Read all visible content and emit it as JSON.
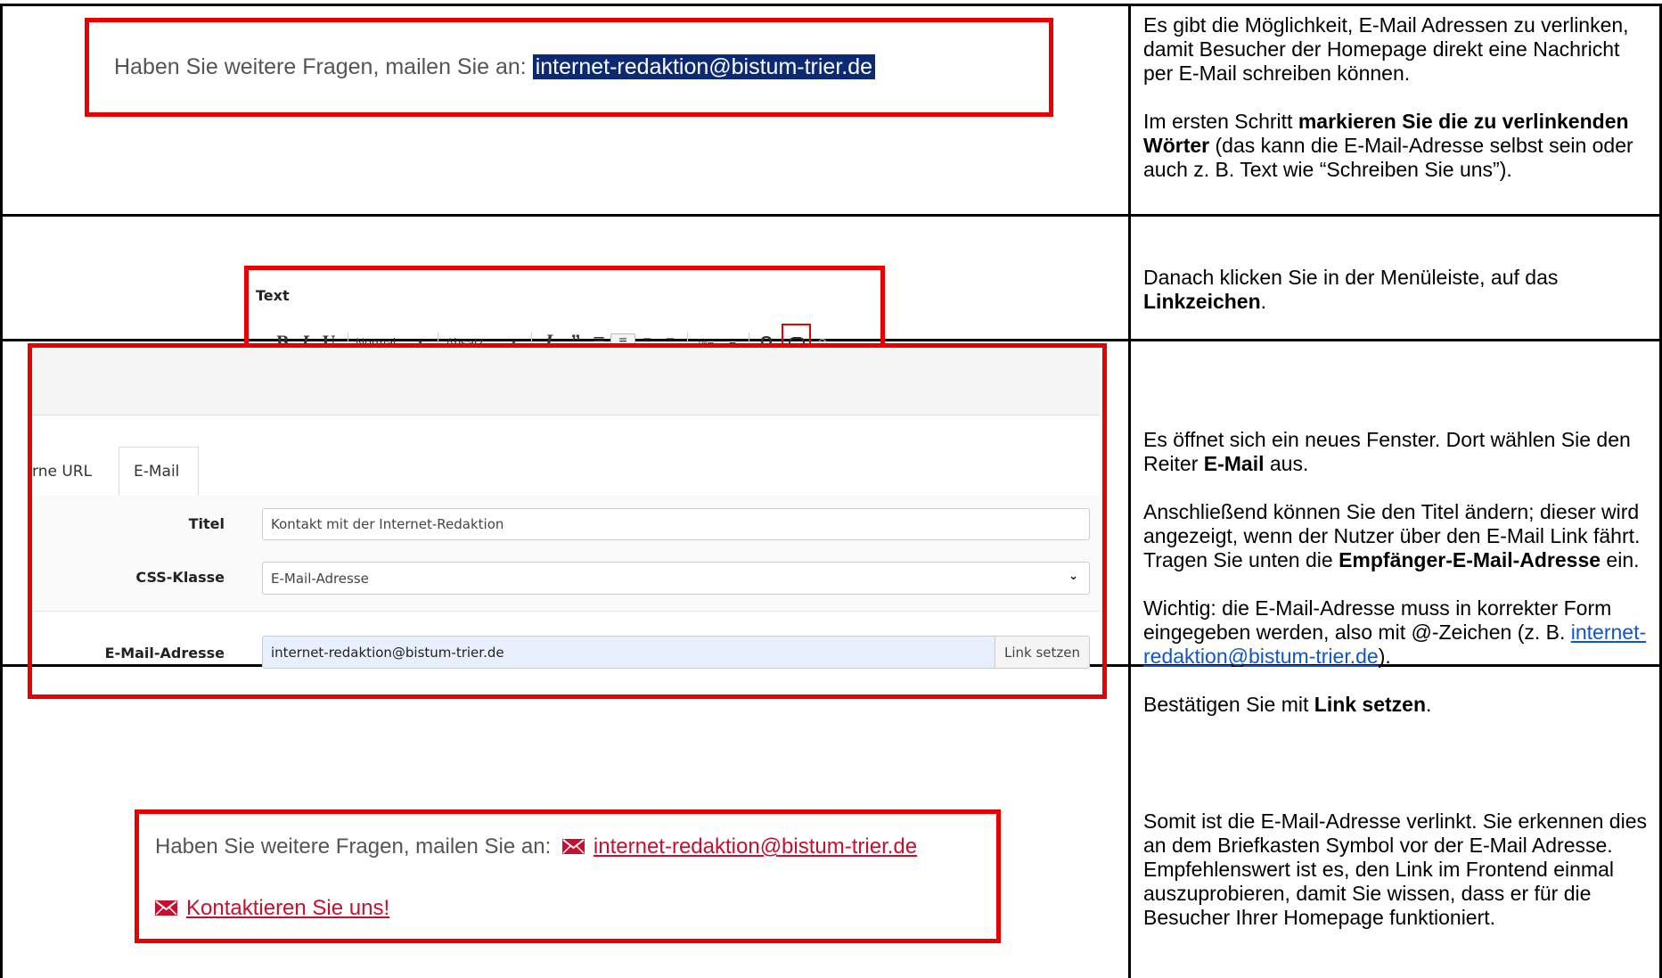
{
  "rows": [
    {
      "screenshot": {
        "sentence": "Haben Sie weitere Fragen, mailen Sie an:",
        "selected_email": "internet-redaktion@bistum-trier.de"
      },
      "paragraphs": [
        {
          "parts": [
            {
              "t": "Es gibt die Möglichkeit, E-Mail Adressen zu verlinken, damit Besucher der Homepage direkt eine Nachricht per E-Mail schreiben können."
            }
          ]
        },
        {
          "parts": [
            {
              "t": "Im ersten Schritt "
            },
            {
              "t": "markieren Sie die zu verlinkenden Wörter",
              "b": true
            },
            {
              "t": " (das kann die E-Mail-Adresse selbst sein oder auch z. B. Text wie “Schreiben Sie uns”)."
            }
          ]
        }
      ]
    },
    {
      "screenshot": {
        "label": "Text",
        "bold": "B",
        "italic": "I",
        "underline": "U",
        "style_select": "Normal",
        "format_select": "Absatz",
        "omega": "Ω"
      },
      "paragraphs": [
        {
          "parts": [
            {
              "t": "Danach klicken Sie in der Menüleiste, auf das "
            },
            {
              "t": "Linkzeichen",
              "b": true
            },
            {
              "t": "."
            }
          ]
        }
      ]
    },
    {
      "screenshot": {
        "tab_url": "rne URL",
        "tab_email": "E-Mail",
        "titel_label": "Titel",
        "titel_value": "Kontakt mit der Internet-Redaktion",
        "css_label": "CSS-Klasse",
        "css_value": "E-Mail-Adresse",
        "email_label": "E-Mail-Adresse",
        "email_value": "internet-redaktion@bistum-trier.de",
        "submit": "Link setzen"
      },
      "paragraphs": [
        {
          "parts": [
            {
              "t": "Es öffnet sich ein neues Fenster. Dort wählen Sie den Reiter "
            },
            {
              "t": "E-Mail",
              "b": true
            },
            {
              "t": " aus."
            }
          ]
        },
        {
          "parts": [
            {
              "t": "Anschließend können Sie den Titel ändern; dieser wird angezeigt, wenn der Nutzer über den E-Mail Link fährt. Tragen Sie unten die "
            },
            {
              "t": "Empfänger-E-Mail-Adresse",
              "b": true
            },
            {
              "t": " ein."
            }
          ]
        },
        {
          "parts": [
            {
              "t": "Wichtig: die E-Mail-Adresse muss in korrekter Form eingegeben werden, also mit @-Zeichen (z. B. "
            },
            {
              "t": "internet-redaktion@bistum-trier.de",
              "link": true
            },
            {
              "t": ")."
            }
          ]
        },
        {
          "parts": [
            {
              "t": "Bestätigen Sie mit "
            },
            {
              "t": "Link setzen",
              "b": true
            },
            {
              "t": "."
            }
          ]
        }
      ]
    },
    {
      "screenshot": {
        "sentence": "Haben Sie weitere Fragen, mailen Sie an:",
        "email_link": "internet-redaktion@bistum-trier.de",
        "contact_link": "Kontaktieren Sie uns!"
      },
      "paragraphs": [
        {
          "parts": [
            {
              "t": "Somit ist die E-Mail-Adresse verlinkt. Sie erkennen dies an dem Briefkasten Symbol vor der E-Mail Adresse."
            }
          ]
        },
        {
          "parts": [
            {
              "t": "Empfehlenswert ist es, den Link im Frontend einmal auszuprobieren, damit Sie wissen, dass er für die Besucher Ihrer Homepage funktioniert."
            }
          ]
        }
      ],
      "tight": true
    }
  ],
  "colors": {
    "highlight": "#ea0000",
    "selection": "#0b2a73",
    "mail_red": "#c8102e",
    "link_blue": "#1155cc"
  }
}
